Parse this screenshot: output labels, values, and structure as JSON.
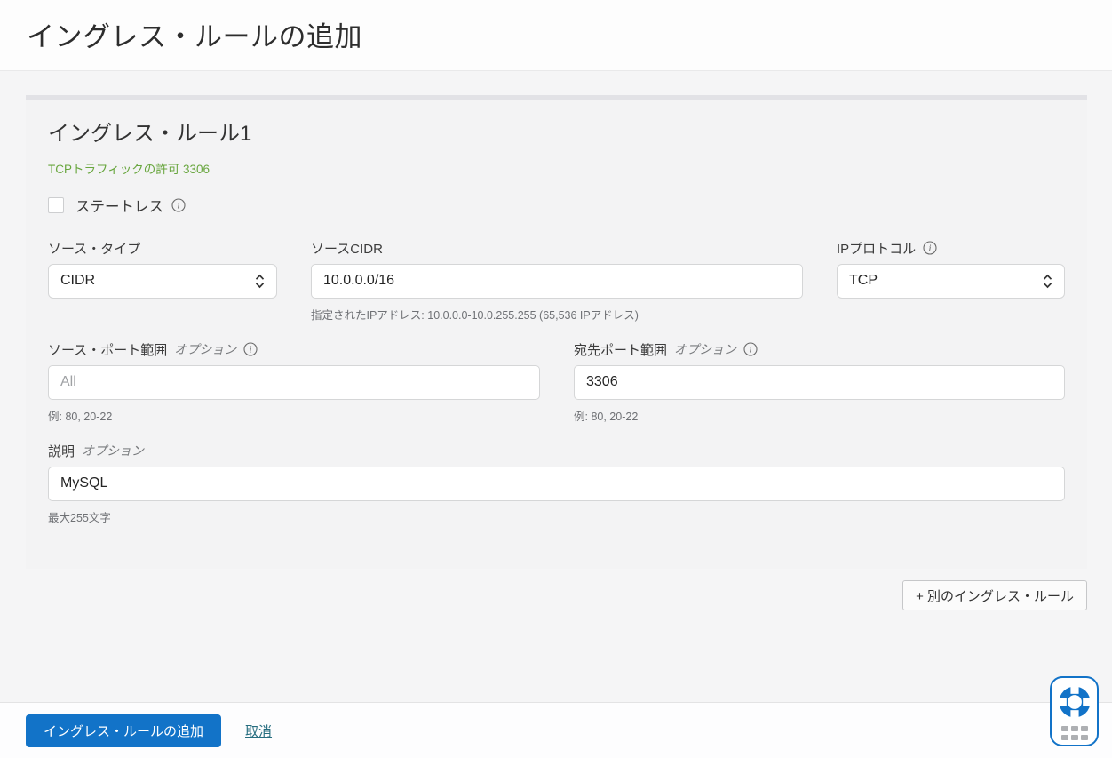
{
  "header": {
    "title": "イングレス・ルールの追加"
  },
  "rule": {
    "heading": "イングレス・ルール1",
    "summary": "TCPトラフィックの許可 3306",
    "stateless_label": "ステートレス",
    "optional_label": "オプション",
    "source_type": {
      "label": "ソース・タイプ",
      "value": "CIDR"
    },
    "source_cidr": {
      "label": "ソースCIDR",
      "value": "10.0.0.0/16",
      "hint": "指定されたIPアドレス: 10.0.0.0-10.0.255.255 (65,536 IPアドレス)"
    },
    "ip_protocol": {
      "label": "IPプロトコル",
      "value": "TCP"
    },
    "source_port": {
      "label": "ソース・ポート範囲",
      "placeholder": "All",
      "hint": "例: 80, 20-22"
    },
    "dest_port": {
      "label": "宛先ポート範囲",
      "value": "3306",
      "hint": "例: 80, 20-22"
    },
    "description": {
      "label": "説明",
      "value": "MySQL",
      "hint": "最大255文字"
    }
  },
  "actions": {
    "add_another_label": "+ 別のイングレス・ルール",
    "submit_label": "イングレス・ルールの追加",
    "cancel_label": "取消"
  },
  "icons": {
    "info_icon": "circled-italic-i",
    "select_chevron_icon": "up-down-chevron",
    "help_icon": "life-ring",
    "drag_handle_icon": "dots-grid"
  },
  "colors": {
    "accent_blue": "#1273c8",
    "success_green": "#68a63e",
    "link_teal": "#266d7f",
    "panel_bg": "#f3f3f4"
  }
}
